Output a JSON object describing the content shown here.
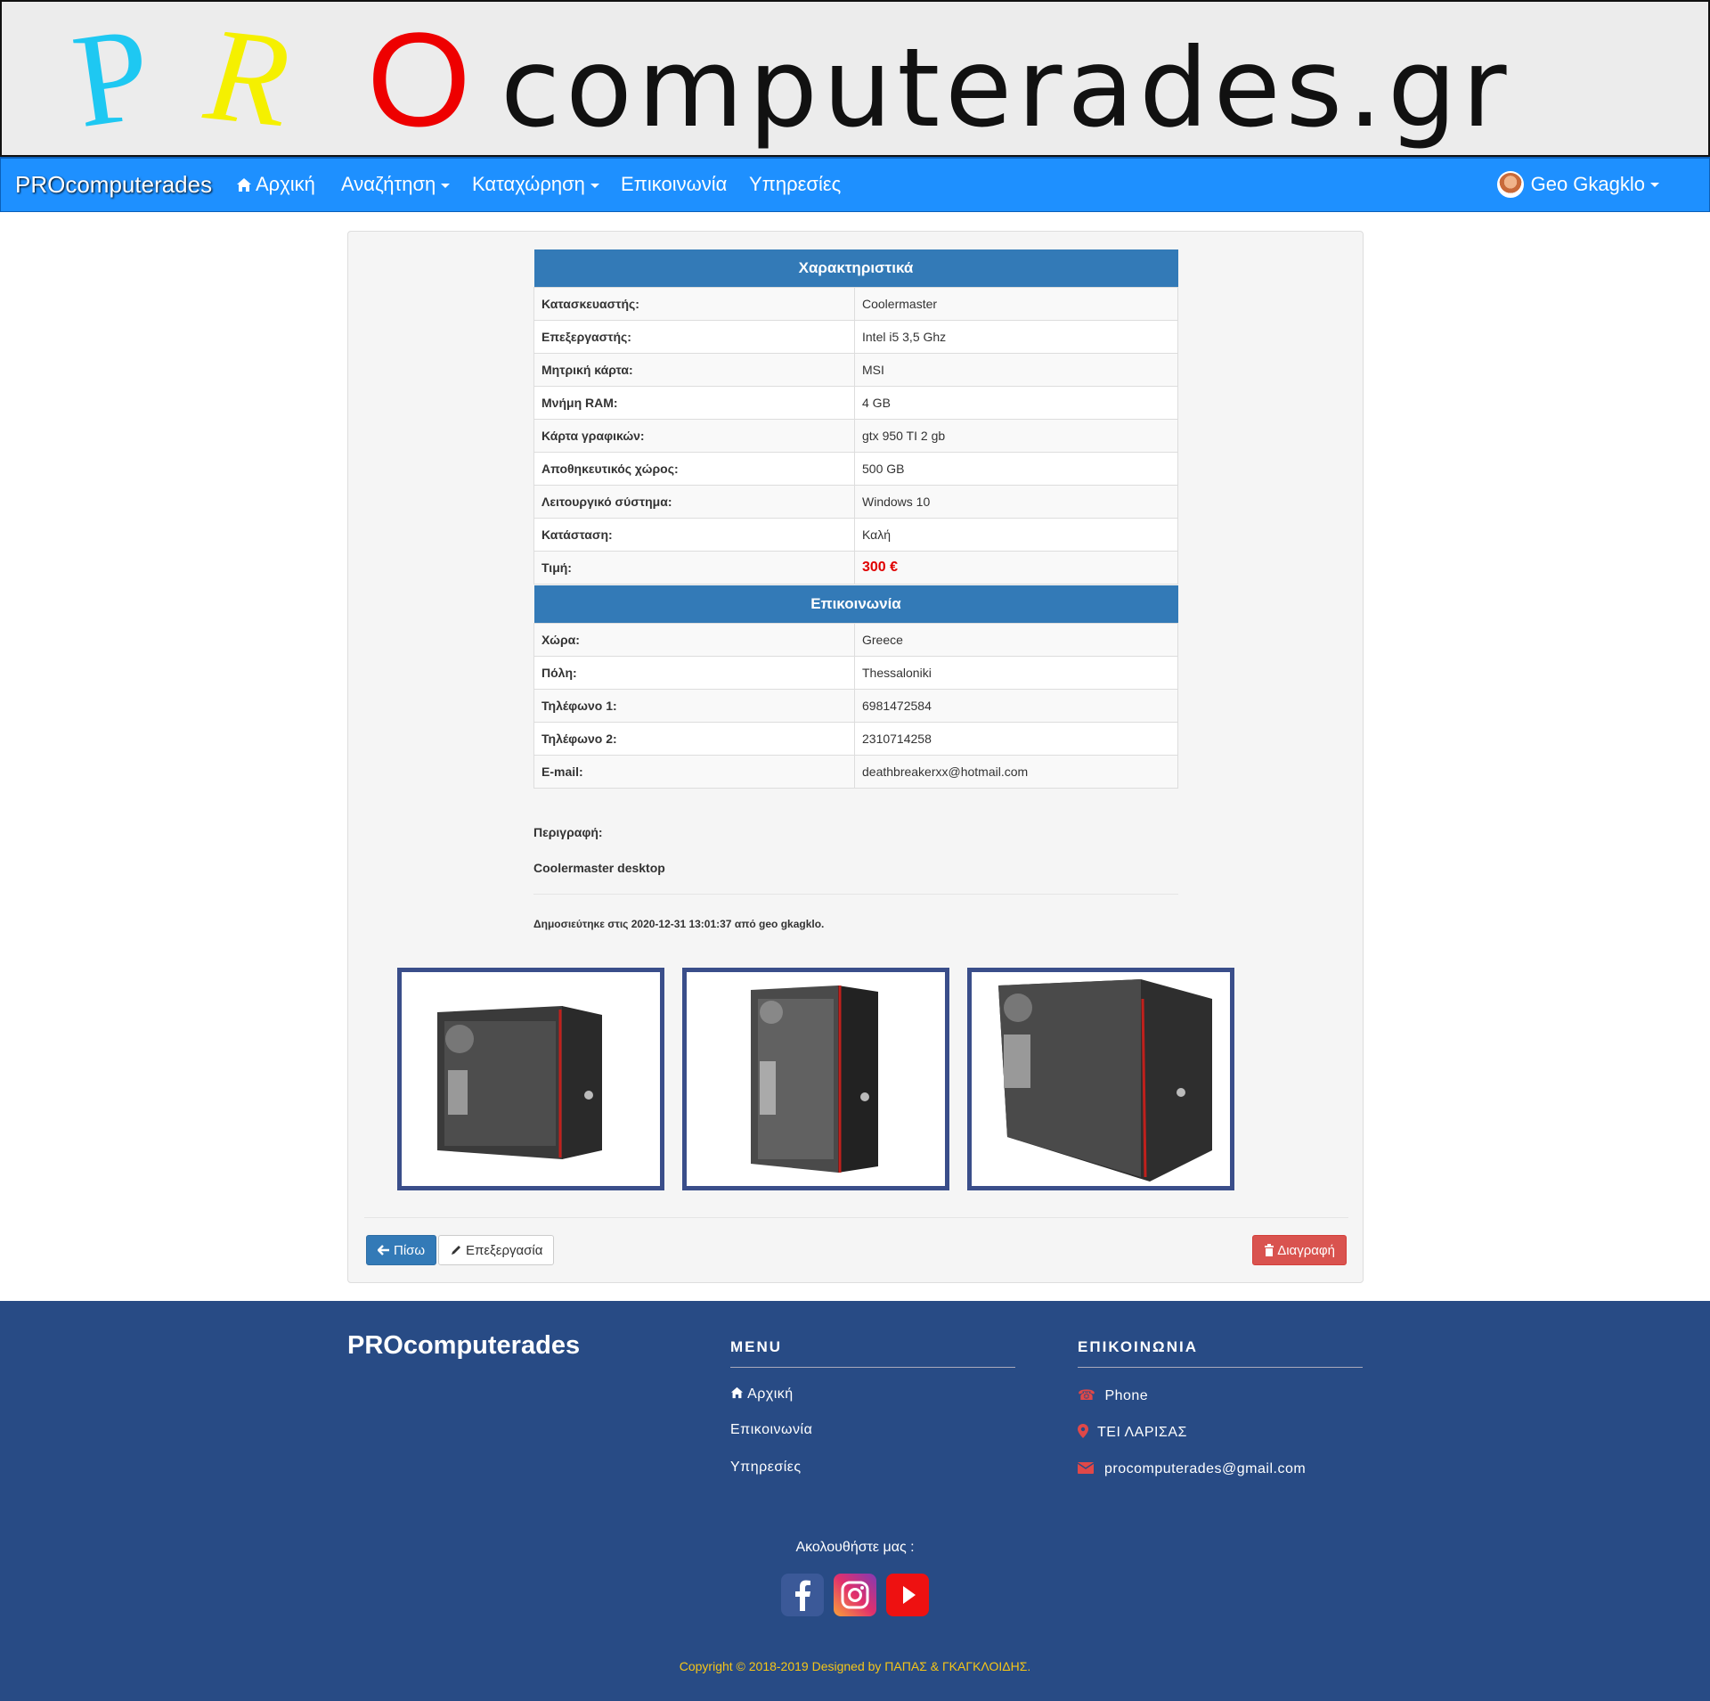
{
  "banner": {
    "letter_p": "P",
    "letter_r": "R",
    "letter_o": "O",
    "rest": "computerades.gr"
  },
  "nav": {
    "brand": "PROcomputerades",
    "items": [
      {
        "label": "Αρχική"
      },
      {
        "label": "Αναζήτηση"
      },
      {
        "label": "Καταχώρηση"
      },
      {
        "label": "Επικοινωνία"
      },
      {
        "label": "Υπηρεσίες"
      }
    ],
    "user": "Geo Gkagklo"
  },
  "specs": {
    "title": "Χαρακτηριστικά",
    "rows": [
      {
        "key": "Κατασκευαστής:",
        "value": "Coolermaster"
      },
      {
        "key": "Επεξεργαστής:",
        "value": "Intel i5 3,5 Ghz"
      },
      {
        "key": "Μητρική κάρτα:",
        "value": "MSI"
      },
      {
        "key": "Μνήμη RAM:",
        "value": "4 GB"
      },
      {
        "key": "Κάρτα γραφικών:",
        "value": "gtx 950 TI 2 gb"
      },
      {
        "key": "Αποθηκευτικός χώρος:",
        "value": "500 GB"
      },
      {
        "key": "Λειτουργικό σύστημα:",
        "value": "Windows 10"
      },
      {
        "key": "Κατάσταση:",
        "value": "Καλή"
      },
      {
        "key": "Τιμή:",
        "value": "300 €"
      }
    ]
  },
  "contact": {
    "title": "Επικοινωνία",
    "rows": [
      {
        "key": "Χώρα:",
        "value": "Greece"
      },
      {
        "key": "Πόλη:",
        "value": "Thessaloniki"
      },
      {
        "key": "Τηλέφωνο 1:",
        "value": "6981472584"
      },
      {
        "key": "Τηλέφωνο 2:",
        "value": "2310714258"
      },
      {
        "key": "E-mail:",
        "value": "deathbreakerxx@hotmail.com"
      }
    ]
  },
  "description": {
    "label": "Περιγραφή:",
    "text": "Coolermaster desktop"
  },
  "published": "Δημοσιεύτηκε στις 2020-12-31 13:01:37 από geo gkagklo.",
  "buttons": {
    "back": "Πίσω",
    "edit": "Επεξεργασία",
    "delete": "Διαγραφή"
  },
  "footer": {
    "brand": "PROcomputerades",
    "menu_title": "MENU",
    "menu": [
      "Αρχική",
      "Επικοινωνία",
      "Υπηρεσίες"
    ],
    "contact_title": "ΕΠΙΚΟΙΝΩΝΙΑ",
    "phone": "Phone",
    "location": "ΤΕΙ ΛΑΡΙΣΑΣ",
    "email": "procomputerades@gmail.com",
    "follow": "Ακολουθήστε μας :",
    "copyright": "Copyright © 2018-2019 Designed by ΠΑΠΑΣ & ΓΚΑΓΚΛΟΙΔΗΣ."
  },
  "colors": {
    "navbar": "#1e90ff",
    "table_header": "#337ab7",
    "footer": "#284b85",
    "price": "#e00000",
    "copyright": "#f5c518"
  },
  "icons": {
    "home": "home-icon",
    "user": "avatar",
    "back": "arrow-left-icon",
    "edit": "pencil-icon",
    "delete": "trash-icon",
    "phone": "phone-icon",
    "location": "map-marker-icon",
    "email": "envelope-icon"
  }
}
